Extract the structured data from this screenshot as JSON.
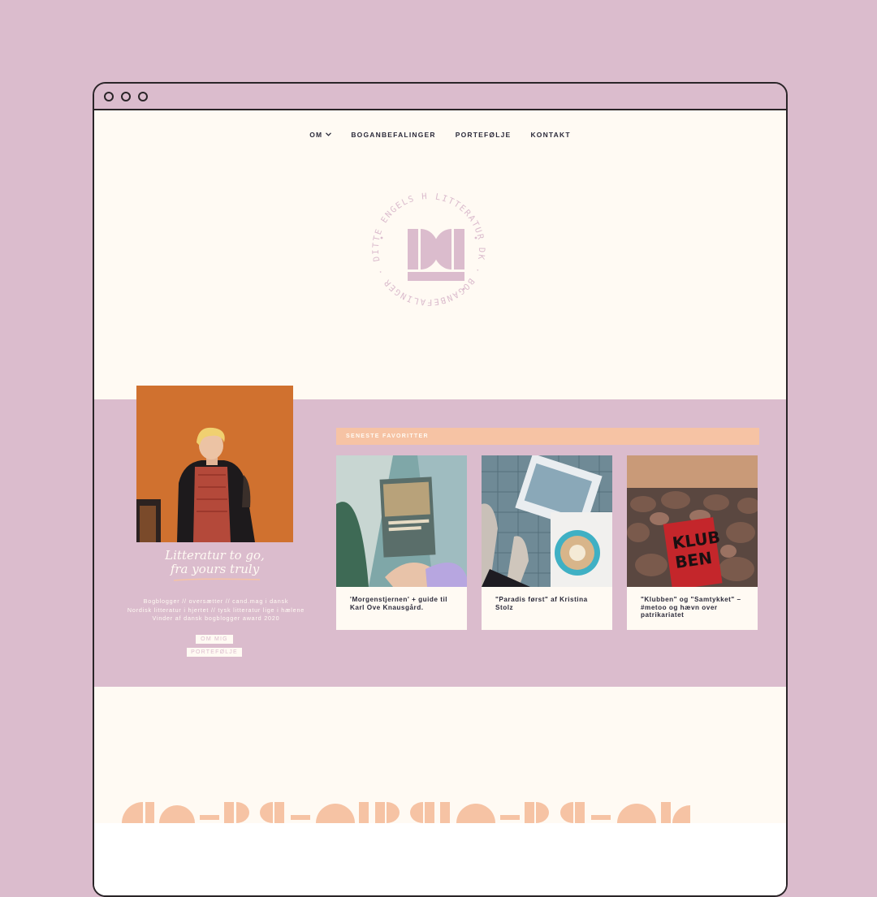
{
  "colors": {
    "background": "#dbbccd",
    "page": "#fffaf3",
    "accent": "#f6c3a4",
    "text": "#2b2a3a",
    "frame": "#2a2528"
  },
  "window": {
    "controls": [
      "window-dot",
      "window-dot",
      "window-dot"
    ]
  },
  "nav": {
    "items": [
      {
        "label": "OM",
        "has_dropdown": true
      },
      {
        "label": "BOGANBEFALINGER"
      },
      {
        "label": "PORTEFØLJE"
      },
      {
        "label": "KONTAKT"
      }
    ]
  },
  "logo": {
    "ring_text": "LITTERATUR DK · BOGANBEFALINGER · DITTE ENGELS HERMANSEN ·",
    "monogram": "DK"
  },
  "profile": {
    "script_line1": "Litteratur to go,",
    "script_line2": "fra yours truly",
    "bio_lines": [
      "Bogblogger // oversætter // cand.mag i dansk",
      "Nordisk litteratur i hjertet // tysk litteratur lige i hælene",
      "Vinder af dansk bogblogger award 2020"
    ],
    "buttons": {
      "about": "OM MIG",
      "portfolio": "PORTEFØLJE"
    }
  },
  "favorites": {
    "heading": "SENESTE FAVORITTER",
    "cards": [
      {
        "title": "'Morgenstjernen' + guide til Karl Ove Knausgård."
      },
      {
        "title": "\"Paradis først\" af Kristina Stolz"
      },
      {
        "title": "\"Klubben\" og \"Samtykket\" – #metoo og hævn over patrikariatet"
      }
    ]
  }
}
